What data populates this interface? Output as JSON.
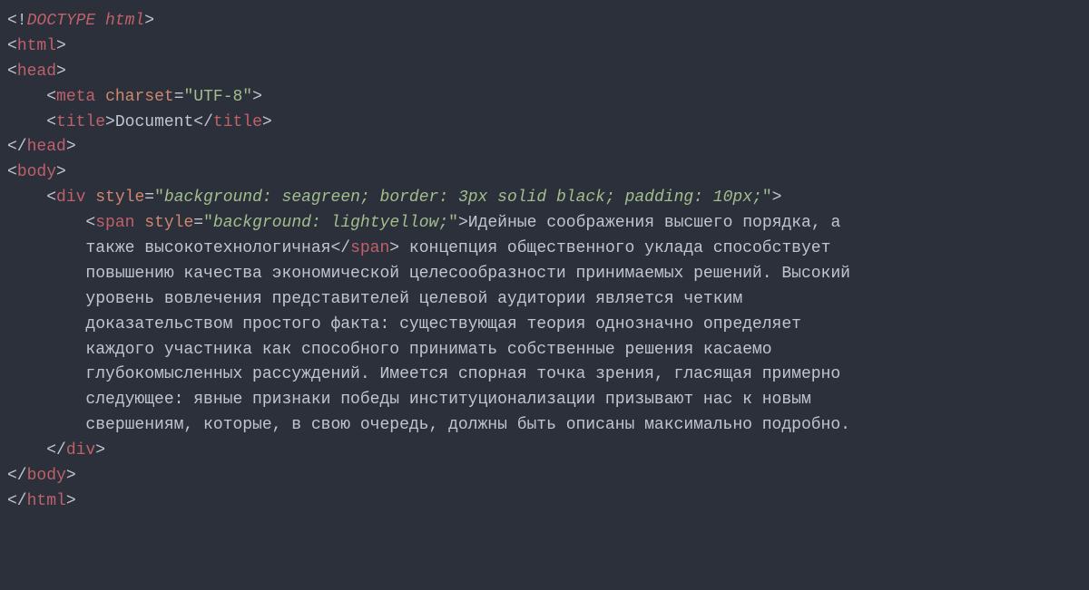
{
  "code": {
    "l01": {
      "open": "<!",
      "doctype": "DOCTYPE html",
      "close": ">"
    },
    "l02": {
      "lt": "<",
      "tag": "html",
      "gt": ">"
    },
    "l03": {
      "lt": "<",
      "tag": "head",
      "gt": ">"
    },
    "l04": {
      "indent": "    ",
      "lt": "<",
      "tag": "meta",
      "sp": " ",
      "attr": "charset",
      "eq": "=",
      "val": "\"UTF-8\"",
      "gt": ">"
    },
    "l05": {
      "indent": "    ",
      "lt": "<",
      "tag": "title",
      "gt": ">",
      "text": "Document",
      "lt2": "</",
      "tag2": "title",
      "gt2": ">"
    },
    "l06": {
      "lt": "</",
      "tag": "head",
      "gt": ">"
    },
    "l07": {
      "lt": "<",
      "tag": "body",
      "gt": ">"
    },
    "l08": {
      "indent": "    ",
      "lt": "<",
      "tag": "div",
      "sp": " ",
      "attr": "style",
      "eq": "=",
      "q1": "\"",
      "css": "background: seagreen; border: 3px solid black; padding: 10px;",
      "q2": "\"",
      "gt": ">"
    },
    "l09": {
      "indent": "        ",
      "lt": "<",
      "tag": "span",
      "sp": " ",
      "attr": "style",
      "eq": "=",
      "q1": "\"",
      "css": "background: lightyellow;",
      "q2": "\"",
      "gt": ">",
      "text1": "Идейные соображения высшего порядка, а"
    },
    "l10": {
      "indent": "        ",
      "text1": "также высокотехнологичная",
      "lt": "</",
      "tag": "span",
      "gt": ">",
      "text2": " концепция общественного уклада способствует"
    },
    "l11": "        повышению качества экономической целесообразности принимаемых решений. Высокий",
    "l12": "        уровень вовлечения представителей целевой аудитории является четким",
    "l13": "        доказательством простого факта: существующая теория однозначно определяет",
    "l14": "        каждого участника как способного принимать собственные решения касаемо",
    "l15": "        глубокомысленных рассуждений. Имеется спорная точка зрения, гласящая примерно",
    "l16": "        следующее: явные признаки победы институционализации призывают нас к новым",
    "l17": "        свершениям, которые, в свою очередь, должны быть описаны максимально подробно.",
    "l18": {
      "indent": "    ",
      "lt": "</",
      "tag": "div",
      "gt": ">"
    },
    "l19": {
      "lt": "</",
      "tag": "body",
      "gt": ">"
    },
    "l20": {
      "lt": "</",
      "tag": "html",
      "gt": ">"
    }
  }
}
